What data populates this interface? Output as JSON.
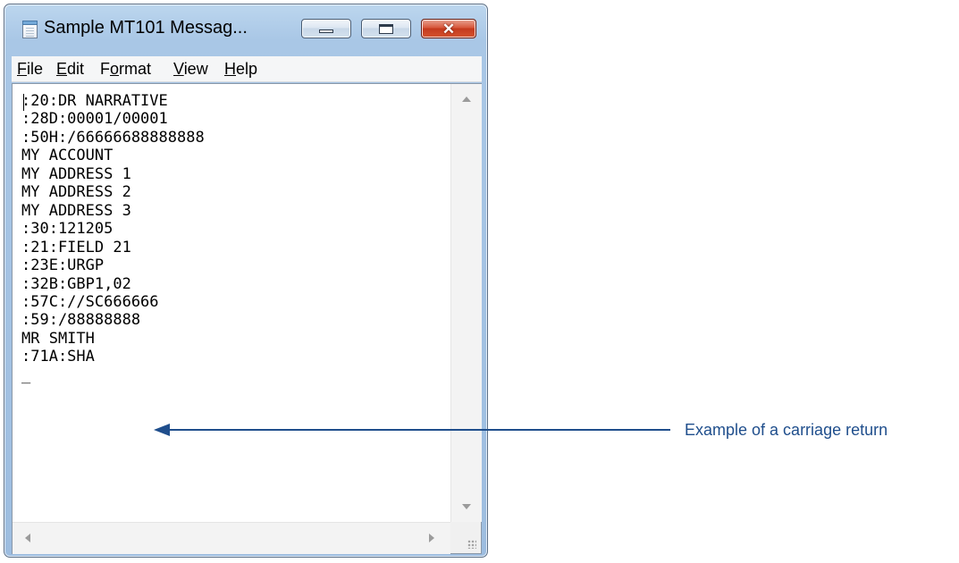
{
  "window": {
    "title": "Sample MT101 Messag...",
    "icon": "notepad-icon"
  },
  "menu": {
    "items": [
      {
        "label_pre": "",
        "accel": "F",
        "label_post": "ile"
      },
      {
        "label_pre": "",
        "accel": "E",
        "label_post": "dit"
      },
      {
        "label_pre": "F",
        "accel": "o",
        "label_post": "rmat"
      },
      {
        "label_pre": "",
        "accel": "V",
        "label_post": "iew"
      },
      {
        "label_pre": "",
        "accel": "H",
        "label_post": "elp"
      }
    ]
  },
  "editor": {
    "content": ":20:DR NARRATIVE\n:28D:00001/00001\n:50H:/66666688888888\nMY ACCOUNT\nMY ADDRESS 1\nMY ADDRESS 2\nMY ADDRESS 3\n:30:121205\n:21:FIELD 21\n:23E:URGP\n:32B:GBP1,02\n:57C://SC666666\n:59:/88888888\nMR SMITH\n:71A:SHA\n_"
  },
  "annotation": {
    "label": "Example of a carriage return",
    "color": "#1f4e8c"
  }
}
